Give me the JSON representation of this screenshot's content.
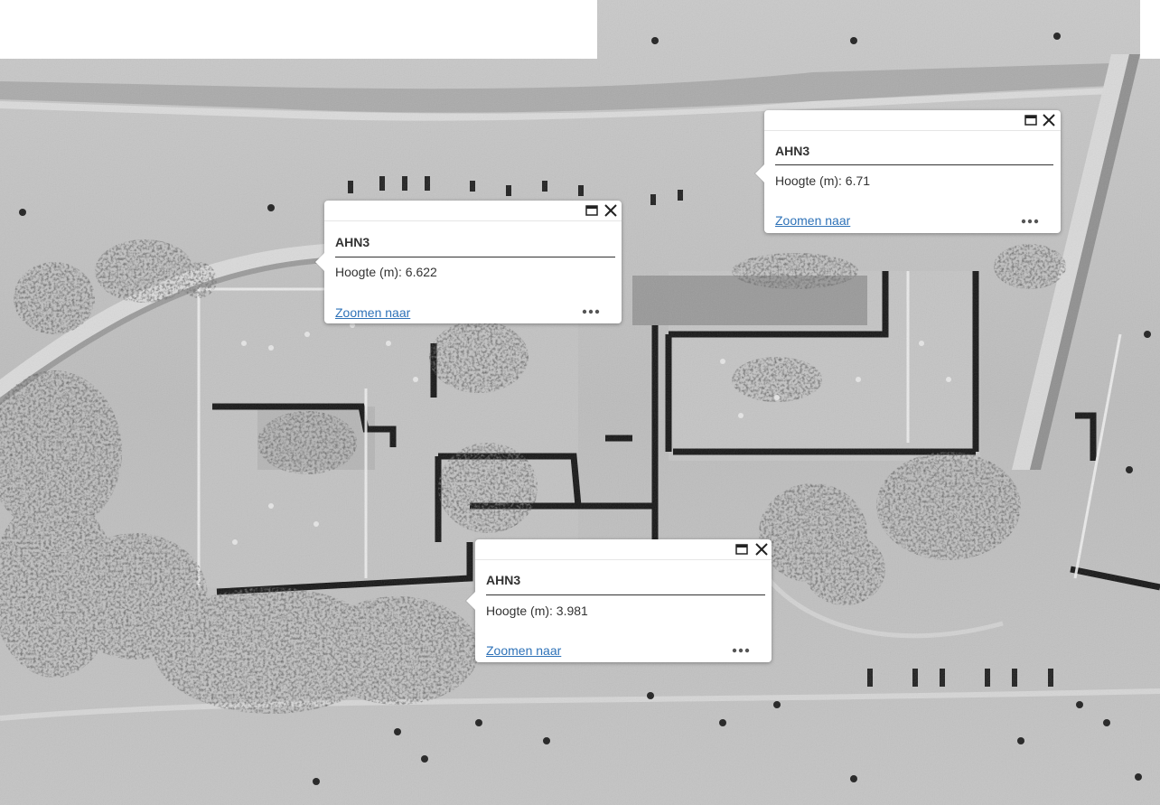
{
  "map": {
    "layer": "AHN3 hillshade"
  },
  "popups": [
    {
      "title": "AHN3",
      "field_label": "Hoogte (m):",
      "field_value": "6.71",
      "field_text": "Hoogte (m): 6.71",
      "zoom_label": "Zoomen naar",
      "dock_icon": "dock-window-icon",
      "close_icon": "close-icon",
      "more_icon": "more-options-icon"
    },
    {
      "title": "AHN3",
      "field_label": "Hoogte (m):",
      "field_value": "6.622",
      "field_text": "Hoogte (m): 6.622",
      "zoom_label": "Zoomen naar",
      "dock_icon": "dock-window-icon",
      "close_icon": "close-icon",
      "more_icon": "more-options-icon"
    },
    {
      "title": "AHN3",
      "field_label": "Hoogte (m):",
      "field_value": "3.981",
      "field_text": "Hoogte (m): 3.981",
      "zoom_label": "Zoomen naar",
      "dock_icon": "dock-window-icon",
      "close_icon": "close-icon",
      "more_icon": "more-options-icon"
    }
  ],
  "colors": {
    "link": "#2e72b8",
    "text": "#323232",
    "popup_bg": "#ffffff",
    "hillshade_base": "#bdbdbd"
  }
}
